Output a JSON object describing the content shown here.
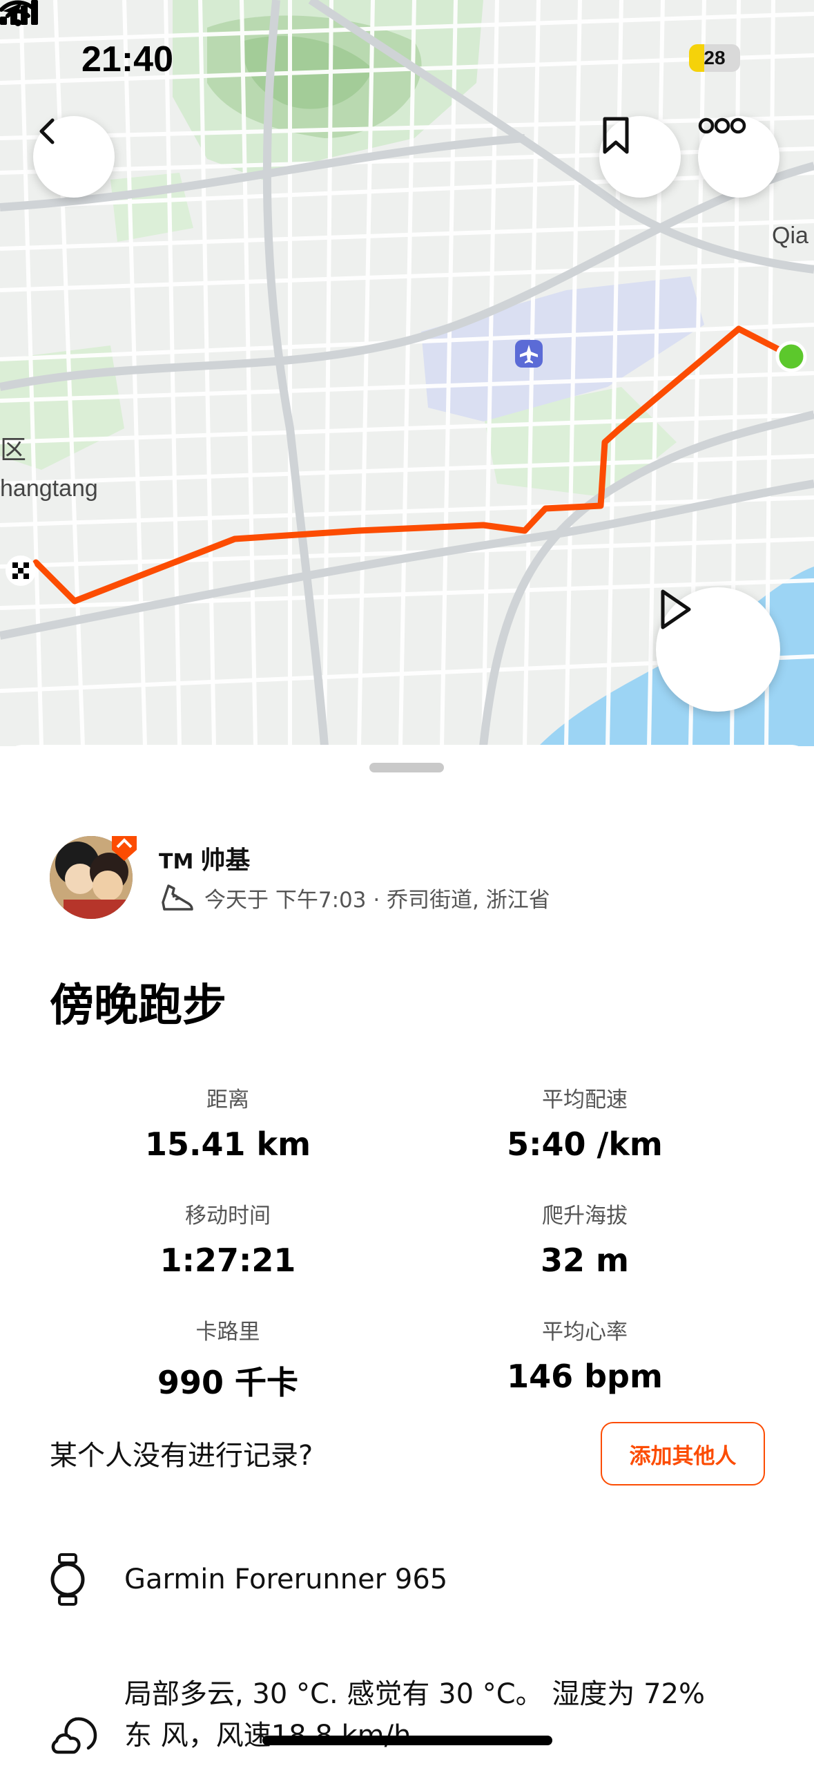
{
  "status_bar": {
    "time": "21:40",
    "battery": "28"
  },
  "map": {
    "labels": {
      "top_right": "Qia",
      "left_district": "区",
      "left_place": "hangtang"
    }
  },
  "colors": {
    "brand": "#fc4c02",
    "route": "#fc4c02",
    "start_marker": "#5cc82c",
    "water": "#9cd4f4"
  },
  "icons": {
    "back": "chevron-left-icon",
    "bookmark": "bookmark-icon",
    "more": "more-icon",
    "play": "play-icon",
    "airport": "airplane-icon",
    "finish": "checkered-flag-icon",
    "shoe": "shoe-icon",
    "watch": "watch-icon",
    "weather": "cloud-moon-icon"
  },
  "athlete": {
    "prefix": "TM",
    "name": "帅基",
    "meta": "今天于 下午7:03 · 乔司街道, 浙江省"
  },
  "activity": {
    "title": "傍晚跑步"
  },
  "stats": [
    {
      "label": "距离",
      "value": "15.41 km"
    },
    {
      "label": "平均配速",
      "value": "5:40 /km"
    },
    {
      "label": "移动时间",
      "value": "1:27:21"
    },
    {
      "label": "爬升海拔",
      "value": "32 m"
    },
    {
      "label": "卡路里",
      "value": "990 千卡"
    },
    {
      "label": "平均心率",
      "value": "146 bpm"
    }
  ],
  "add_others": {
    "question": "某个人没有进行记录?",
    "button": "添加其他人"
  },
  "device": {
    "name": "Garmin Forerunner 965"
  },
  "weather": {
    "line1": "局部多云, 30 °C. 感觉有 30 °C。 湿度为 72%",
    "line2": "东 风，风速18.8 km/h"
  }
}
